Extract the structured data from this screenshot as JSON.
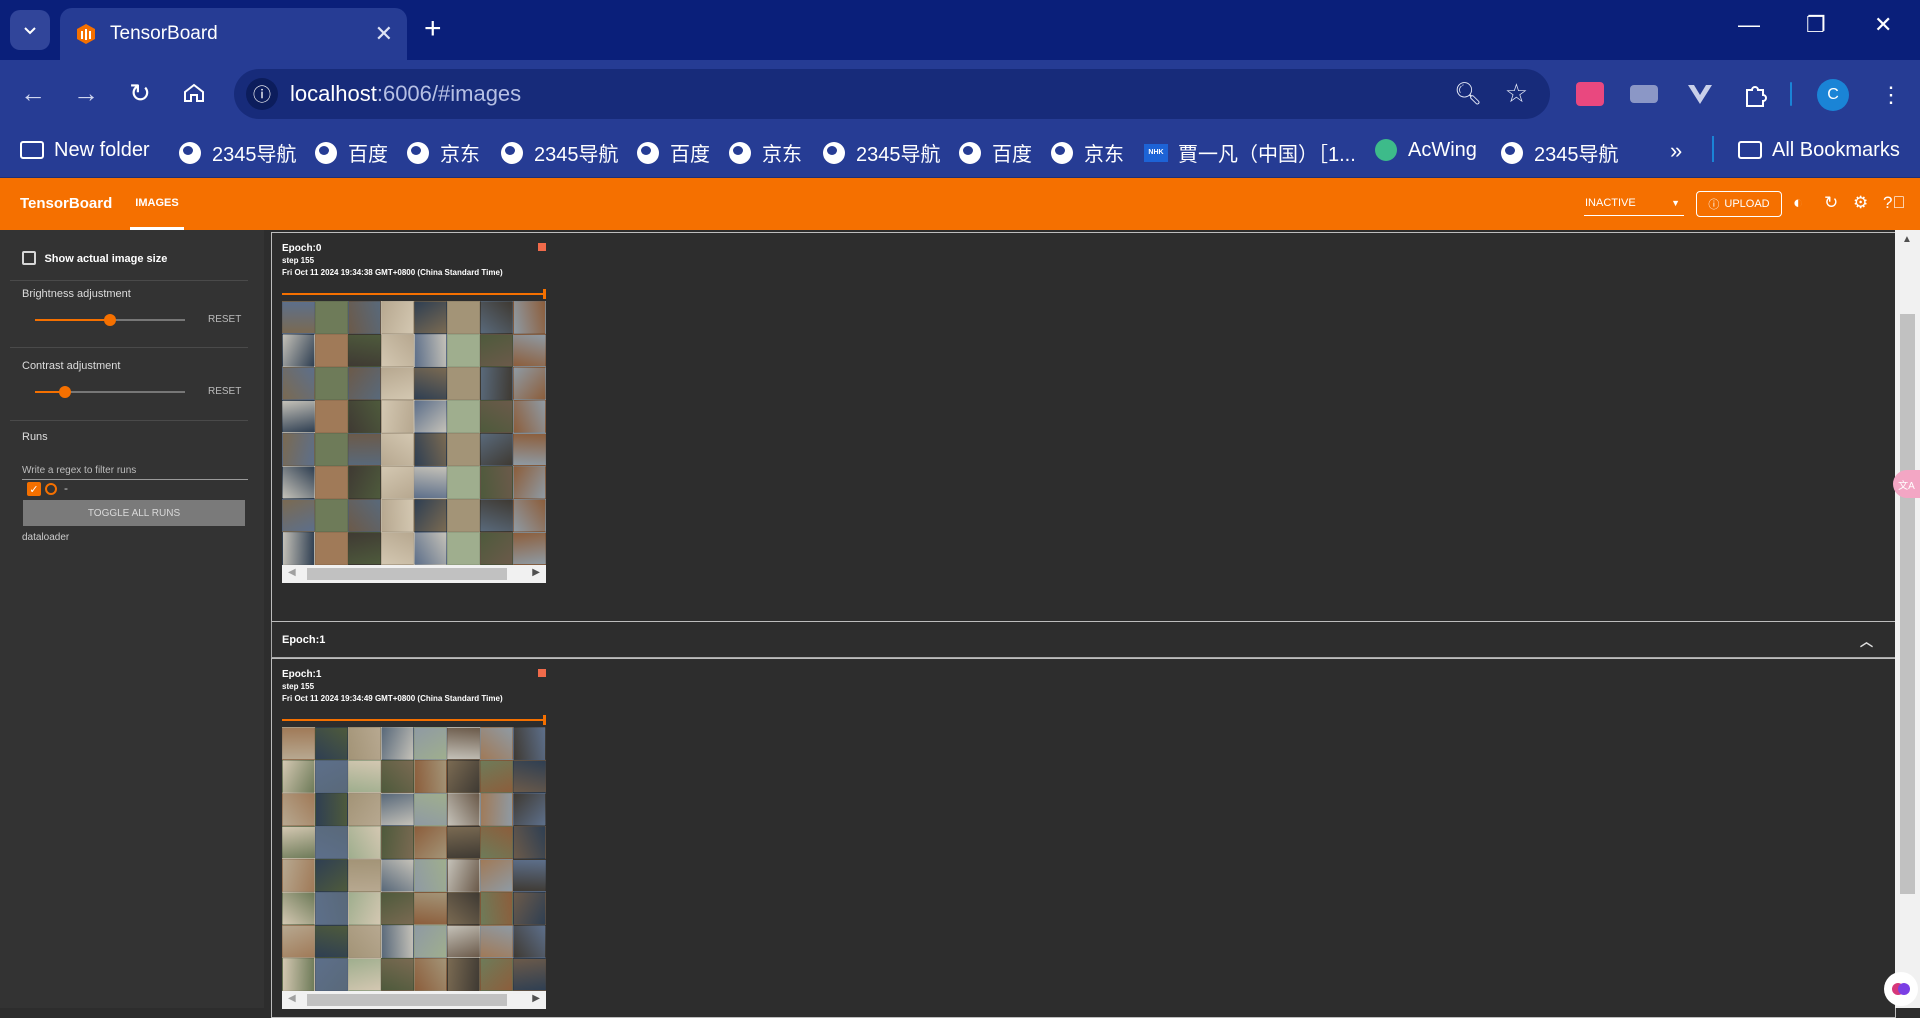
{
  "browser": {
    "tab_title": "TensorBoard",
    "url_host": "localhost",
    "url_rest": ":6006/#images",
    "profile_initial": "C",
    "bookmarks": [
      {
        "label": "New folder",
        "icon": "folder-icon"
      },
      {
        "label": "2345导航",
        "icon": "globe-icon"
      },
      {
        "label": "百度",
        "icon": "globe-icon"
      },
      {
        "label": "京东",
        "icon": "globe-icon"
      },
      {
        "label": "2345导航",
        "icon": "globe-icon"
      },
      {
        "label": "百度",
        "icon": "globe-icon"
      },
      {
        "label": "京东",
        "icon": "globe-icon"
      },
      {
        "label": "2345导航",
        "icon": "globe-icon"
      },
      {
        "label": "百度",
        "icon": "globe-icon"
      },
      {
        "label": "京东",
        "icon": "globe-icon"
      },
      {
        "label": "賈一凡（中国）［1...",
        "icon": "nhk-icon"
      },
      {
        "label": "AcWing",
        "icon": "acwing-icon"
      },
      {
        "label": "2345导航",
        "icon": "globe-icon"
      }
    ],
    "all_bookmarks": "All Bookmarks",
    "overflow": "»"
  },
  "tensorboard": {
    "brand": "TensorBoard",
    "active_tab": "IMAGES",
    "status_select": "INACTIVE",
    "upload_label": "UPLOAD",
    "accent_color": "#f57000"
  },
  "sidebar": {
    "show_actual_size": "Show actual image size",
    "brightness_label": "Brightness adjustment",
    "brightness_value": 0.5,
    "contrast_label": "Contrast adjustment",
    "contrast_value": 0.2,
    "reset_label": "RESET",
    "runs_label": "Runs",
    "filter_placeholder": "Write a regex to filter runs",
    "run_name": "-",
    "toggle_all": "TOGGLE ALL RUNS",
    "dataloader": "dataloader"
  },
  "cards": [
    {
      "title": "Epoch:0",
      "step": "step 155",
      "date": "Fri Oct 11 2024 19:34:38 GMT+0800 (China Standard Time)"
    },
    {
      "header": "Epoch:1",
      "title": "Epoch:1",
      "step": "step 155",
      "date": "Fri Oct 11 2024 19:34:49 GMT+0800 (China Standard Time)"
    }
  ]
}
